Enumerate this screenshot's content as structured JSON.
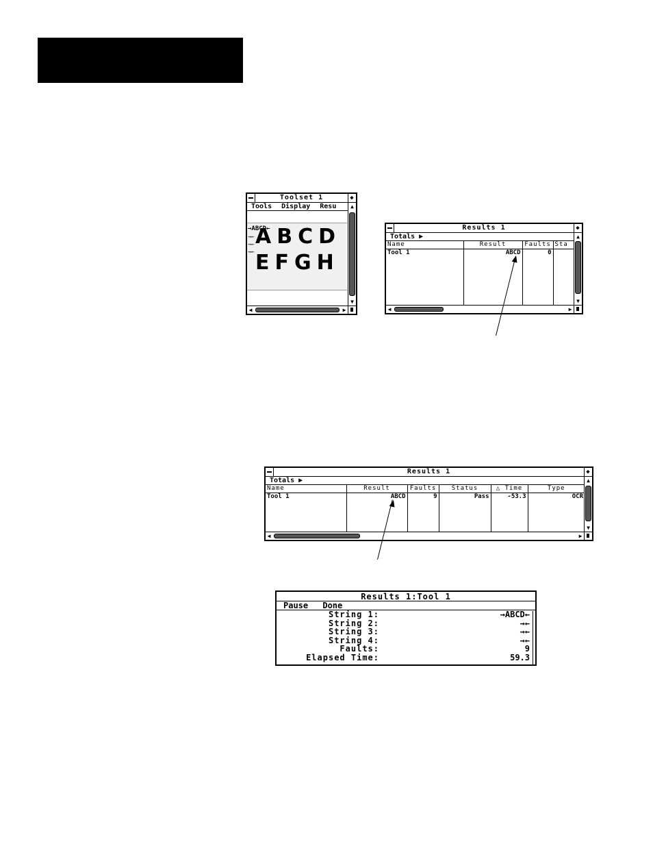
{
  "toolset": {
    "title": "Toolset 1",
    "menu": [
      "Tools",
      "Display",
      "Resu"
    ],
    "string_lines": [
      "→ABCD←",
      "→←",
      "→←",
      "→←"
    ],
    "row1": "ABCD",
    "row2": "EFGH"
  },
  "results_small": {
    "title": "Results 1",
    "totals": "Totals ▶",
    "columns": [
      "Name",
      "Result",
      "Faults",
      "Sta"
    ],
    "row": {
      "name": "Tool 1",
      "result": "ABCD",
      "faults": "0"
    }
  },
  "results_wide": {
    "title": "Results 1",
    "totals": "Totals ▶",
    "columns": [
      "Name",
      "Result",
      "Faults",
      "Status",
      "△ Time",
      "Type"
    ],
    "row": {
      "name": "Tool 1",
      "result": "ABCD",
      "faults": "9",
      "status": "Pass",
      "time": "-53.3",
      "type": "OCR"
    }
  },
  "detail": {
    "title": "Results 1:Tool 1",
    "menu": [
      "Pause",
      "Done"
    ],
    "rows": [
      {
        "label": "String 1:",
        "value": "→ABCD←"
      },
      {
        "label": "String 2:",
        "value": "→←"
      },
      {
        "label": "String 3:",
        "value": "→←"
      },
      {
        "label": "String 4:",
        "value": "→←"
      },
      {
        "label": "Faults:",
        "value": "9"
      },
      {
        "label": "Elapsed Time:",
        "value": "59.3"
      }
    ]
  },
  "icons": {
    "system_menu": "minus-icon",
    "size": "diamond-icon",
    "scroll_up": "arrow-up-icon",
    "scroll_down": "arrow-down-icon",
    "scroll_left": "arrow-left-icon",
    "scroll_right": "arrow-right-icon"
  }
}
